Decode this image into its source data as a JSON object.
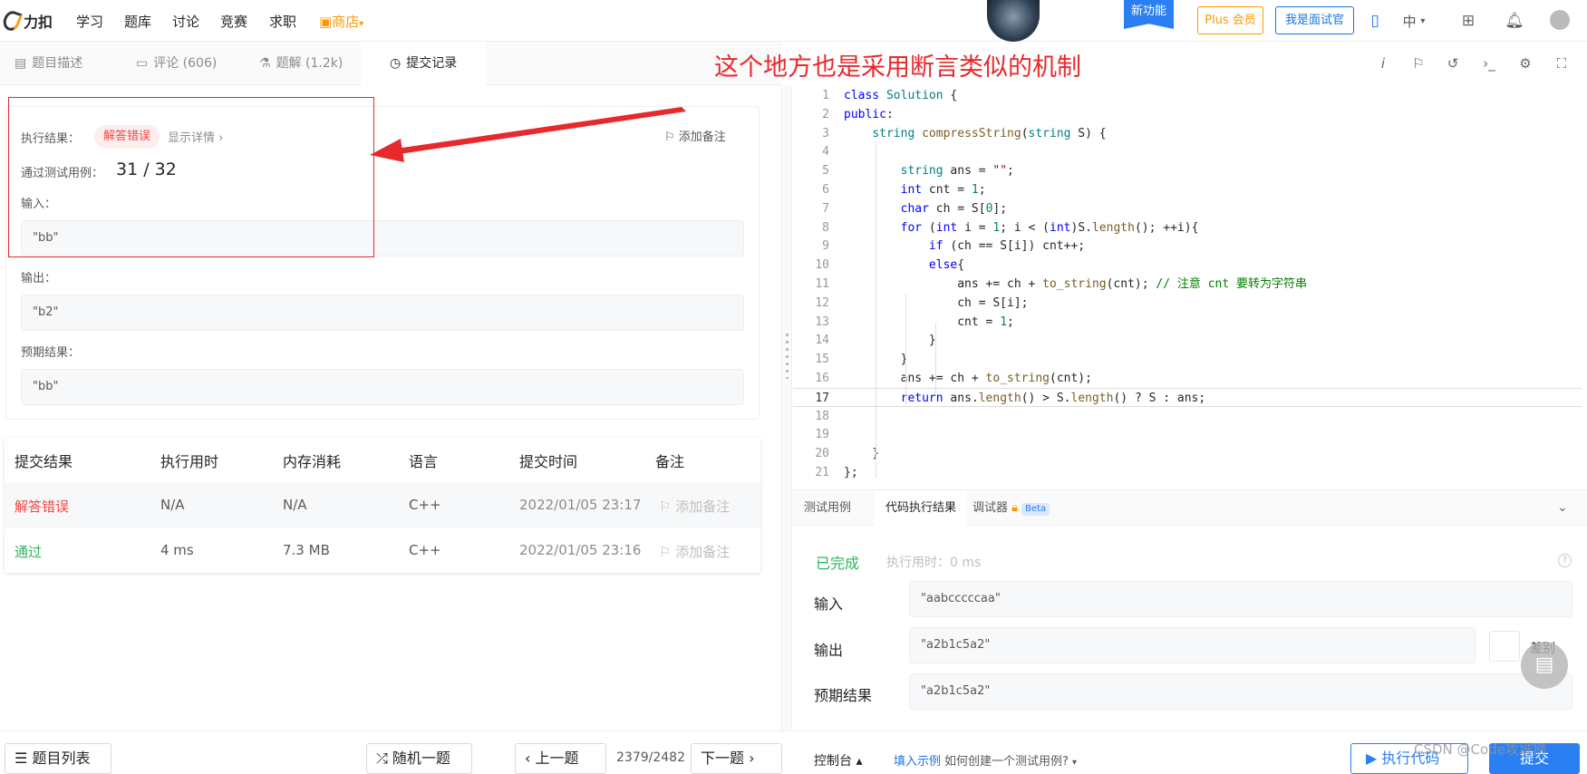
{
  "nav": {
    "logo_text": "力扣",
    "items": [
      "学习",
      "题库",
      "讨论",
      "竞赛",
      "求职"
    ],
    "store": "商店",
    "new_feature": "新功能",
    "plus": "Plus 会员",
    "interviewer": "我是面试官",
    "lang": "中"
  },
  "left_tabs": [
    "题目描述",
    "评论 (606)",
    "题解 (1.2k)",
    "提交记录"
  ],
  "annotation": "这个地方也是采用断言类似的机制",
  "result": {
    "exec_label": "执行结果：",
    "status": "解答错误",
    "detail": "显示详情 ›",
    "add_note": "添加备注",
    "passed_label": "通过测试用例：",
    "passed": "31 / 32",
    "input_label": "输入：",
    "input": "\"bb\"",
    "output_label": "输出：",
    "output": "\"b2\"",
    "expected_label": "预期结果：",
    "expected": "\"bb\""
  },
  "submissions": {
    "headers": [
      "提交结果",
      "执行用时",
      "内存消耗",
      "语言",
      "提交时间",
      "备注"
    ],
    "rows": [
      {
        "result": "解答错误",
        "time": "N/A",
        "memory": "N/A",
        "lang": "C++",
        "submitted": "2022/01/05 23:17",
        "note": "添加备注"
      },
      {
        "result": "通过",
        "time": "4 ms",
        "memory": "7.3 MB",
        "lang": "C++",
        "submitted": "2022/01/05 23:16",
        "note": "添加备注"
      }
    ]
  },
  "code_lines": [
    "class Solution {",
    "public:",
    "    string compressString(string S) {",
    "",
    "        string ans = \"\";",
    "        int cnt = 1;",
    "        char ch = S[0];",
    "        for (int i = 1; i < (int)S.length(); ++i){",
    "            if (ch == S[i]) cnt++;",
    "            else{",
    "                ans += ch + to_string(cnt); // 注意 cnt 要转为字符串",
    "                ch = S[i];",
    "                cnt = 1;",
    "            }",
    "        }",
    "        ans += ch + to_string(cnt);",
    "        return ans.length() > S.length() ? S : ans;",
    "",
    "",
    "    }",
    "};"
  ],
  "console": {
    "tabs": [
      "测试用例",
      "代码执行结果",
      "调试器"
    ],
    "beta": "Beta",
    "done": "已完成",
    "runtime": "执行用时：0 ms",
    "input_label": "输入",
    "input": "\"aabcccccaa\"",
    "output_label": "输出",
    "output": "\"a2b1c5a2\"",
    "expected_label": "预期结果",
    "expected": "\"a2b1c5a2\"",
    "diff": "差别"
  },
  "bottom": {
    "list": "题目列表",
    "random": "随机一题",
    "prev": "上一题",
    "count": "2379/2482",
    "next": "下一题",
    "console": "控制台 ▴",
    "fill_example": "填入示例",
    "howto": "如何创建一个测试用例?",
    "run": "执行代码",
    "submit": "提交",
    "watermark": "CSDN @Code攻城狮"
  }
}
